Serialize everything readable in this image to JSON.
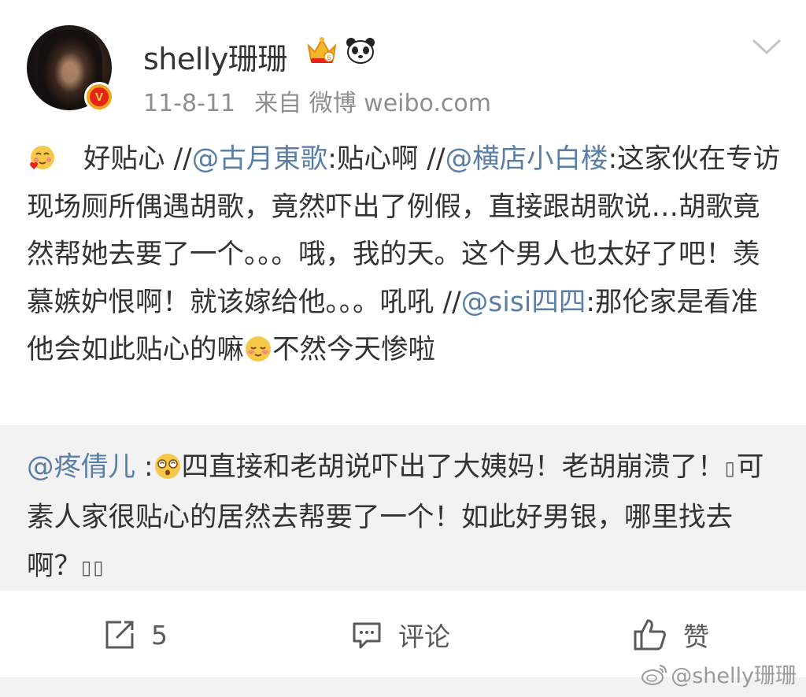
{
  "header": {
    "username": "shelly珊珊",
    "time": "11-8-11",
    "source": "来自 微博 weibo.com",
    "verified_badge": "V",
    "badge_icons": [
      "crown-vip-icon",
      "panda-icon"
    ],
    "menu_icon": "chevron-down-icon"
  },
  "post": {
    "text_1": "好贴心 //",
    "mention_1": "@古月東歌",
    "text_2": ":贴心啊 //",
    "mention_2": "@横店小白楼",
    "text_3": ":这家伙在专访现场厕所偶遇胡歌，竟然吓出了例假，直接跟胡歌说…胡歌竟然帮她去要了一个。。。哦，我的天。这个男人也太好了吧！羡慕嫉妒恨啊！就该嫁给他。。。吼吼 //",
    "mention_3": "@sisi四四",
    "text_4": ":那伦家是看准他会如此贴心的嘛",
    "text_5": "不然今天惨啦"
  },
  "quote": {
    "mention": "@疼倩儿",
    "text_1": " :",
    "text_2": "四直接和老胡说吓出了大姨妈！老胡崩溃了！",
    "tofu_1": "▯",
    "text_3": "可素人家很贴心的居然去帮要了一个！如此好男银，哪里找去啊？",
    "tofu_2": "▯▯"
  },
  "actions": {
    "share_count": "5",
    "comment_label": "评论",
    "like_label": "赞"
  },
  "watermark": "@shelly珊珊",
  "colors": {
    "mention": "#5a7ea6",
    "text": "#333333",
    "meta": "#8e8e8e",
    "quote_bg": "#f2f2f2",
    "verify_bg": "#f0a51a"
  }
}
